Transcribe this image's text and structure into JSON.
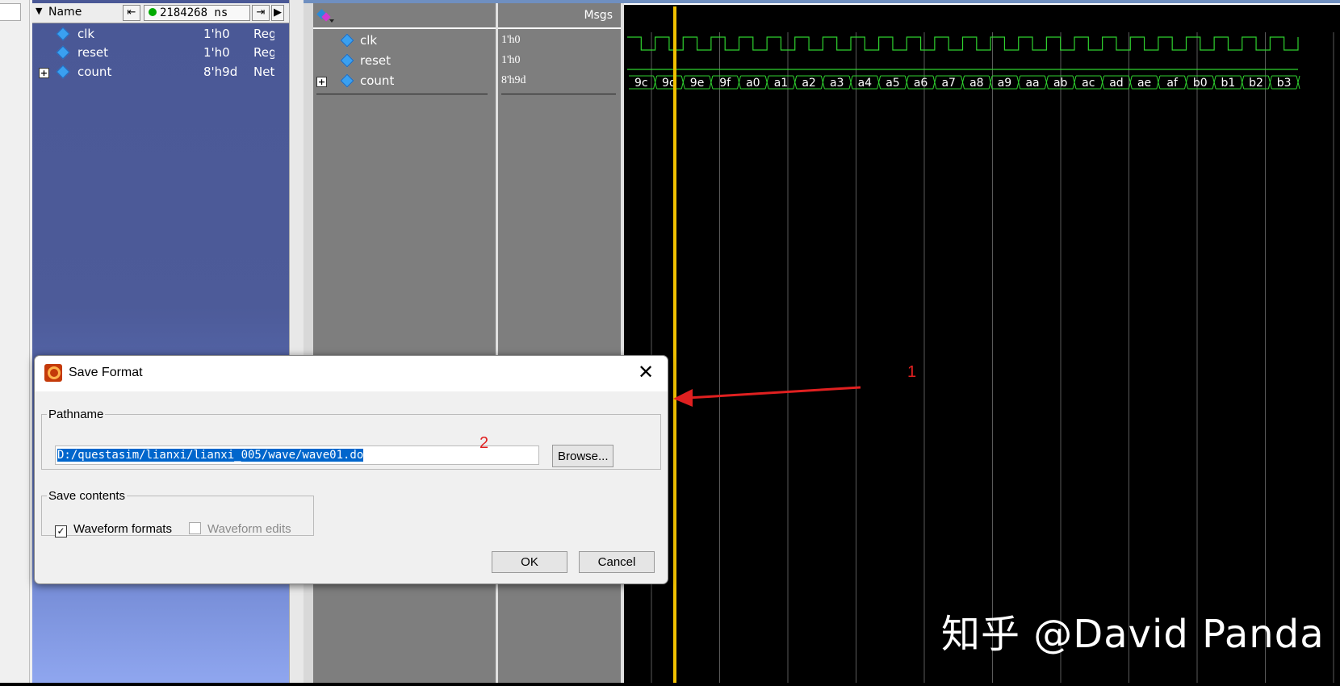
{
  "objects": {
    "header": {
      "name_label": "Name",
      "time": "2184268 ns"
    },
    "rows": [
      {
        "name": "clk",
        "value": "1'h0",
        "kind": "Reg"
      },
      {
        "name": "reset",
        "value": "1'h0",
        "kind": "Reg"
      },
      {
        "name": "count",
        "value": "8'h9d",
        "kind": "Net"
      }
    ]
  },
  "wave": {
    "msgs_label": "Msgs",
    "signals": [
      {
        "name": "clk",
        "value": "1'h0"
      },
      {
        "name": "reset",
        "value": "1'h0"
      },
      {
        "name": "count",
        "value": "8'h9d"
      }
    ],
    "count_sequence": [
      "9c",
      "9d",
      "9e",
      "9f",
      "a0",
      "a1",
      "a2",
      "a3",
      "a4",
      "a5",
      "a6",
      "a7",
      "a8",
      "a9",
      "aa",
      "ab",
      "ac",
      "ad",
      "ae",
      "af",
      "b0",
      "b1",
      "b2",
      "b3"
    ],
    "colors": {
      "signal": "#2fd12f",
      "cursor": "#f0c000",
      "grid": "#5a5a5a"
    }
  },
  "dialog": {
    "title": "Save Format",
    "pathname_legend": "Pathname",
    "path_value": "D:/questasim/lianxi/lianxi_005/wave/wave01.do",
    "browse_label": "Browse...",
    "contents_legend": "Save contents",
    "waveform_formats_label": "Waveform formats",
    "waveform_formats_checked": true,
    "waveform_edits_label": "Waveform edits",
    "waveform_edits_checked": false,
    "ok_label": "OK",
    "cancel_label": "Cancel",
    "close_glyph": "✕"
  },
  "annotations": {
    "marker1": "1",
    "marker2": "2",
    "color": "#e02020"
  },
  "watermark": "知乎 @David Panda"
}
